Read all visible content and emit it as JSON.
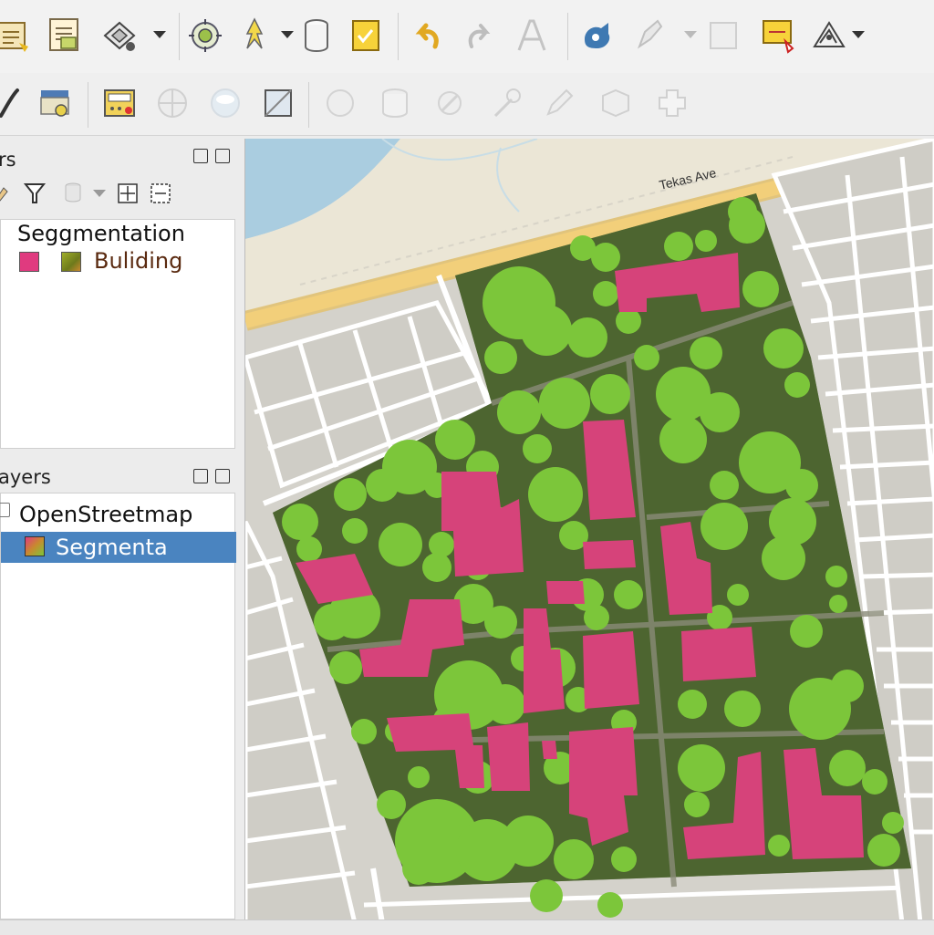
{
  "toolbar_top": {
    "icons": [
      "new-project-icon",
      "open-project-icon",
      "layer-properties-icon",
      "map-navigation-icon",
      "digitize-icon",
      "database-icon",
      "note-icon",
      "undo-icon",
      "redo-icon",
      "label-icon",
      "style-icon",
      "edit-vertex-icon",
      "blank-tool-icon",
      "select-features-icon",
      "measure-icon"
    ]
  },
  "toolbar_second": {
    "icons": [
      "pen-icon",
      "layout-icon",
      "calculator-icon",
      "globe-icon",
      "sphere-icon",
      "frame-icon",
      "web-icon",
      "cylinder-icon",
      "snap-icon",
      "wand-icon",
      "pencil-icon",
      "split-icon",
      "node-icon"
    ]
  },
  "layers_panel": {
    "title": "rs",
    "items": [
      {
        "label": "Seggmentation",
        "type": "group"
      },
      {
        "label": "Buliding",
        "type": "child",
        "color": "#e03a7f"
      }
    ]
  },
  "browser_panel": {
    "title": "ayers",
    "items": [
      {
        "label": "OpenStreetmap",
        "type": "layer"
      },
      {
        "label": "Segmenta",
        "type": "layer",
        "selected": true
      }
    ]
  },
  "map": {
    "street_label": "Tekas Ave",
    "colors": {
      "building": "#d6437a",
      "vegetation": "#7cc63a",
      "water": "#aacde0",
      "road_major": "#f2cf7a",
      "road_minor": "#ffffff",
      "parcel": "#d2d0c9"
    }
  },
  "accent_selection": "#4a84c0"
}
